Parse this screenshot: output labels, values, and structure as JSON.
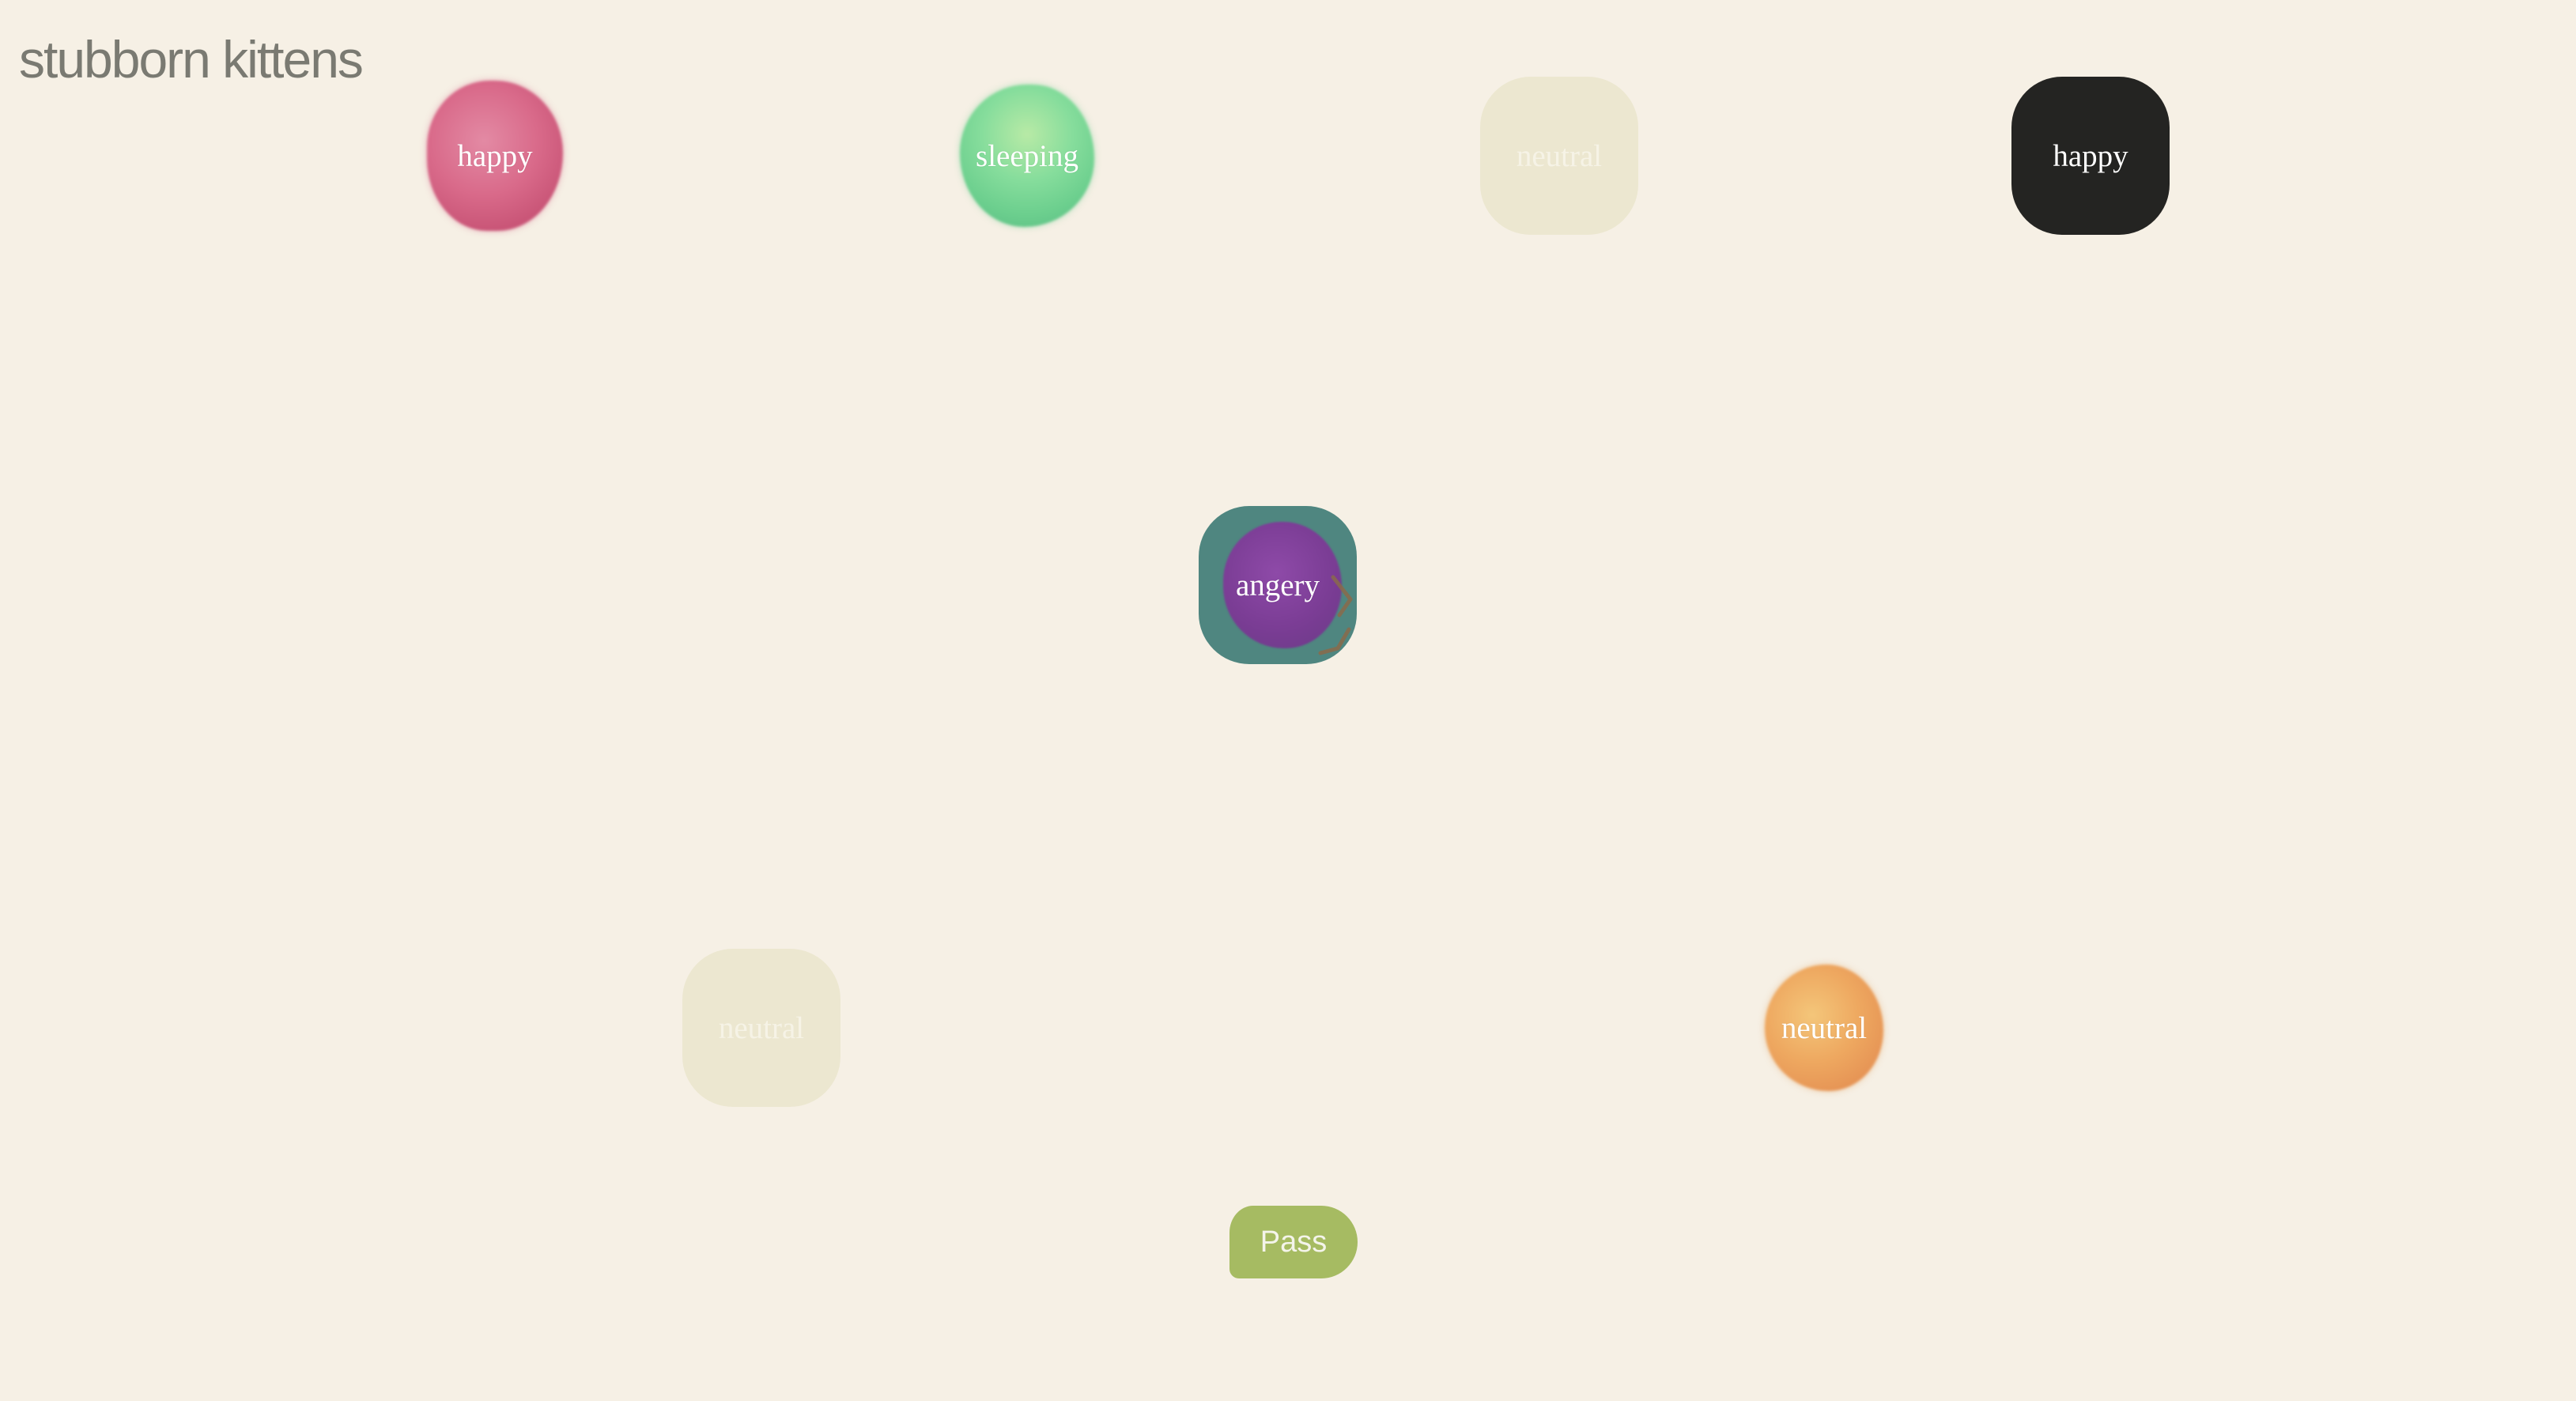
{
  "app": {
    "title": "stubborn kittens"
  },
  "tokens": [
    {
      "label": "happy",
      "style": "pink-blob",
      "color": "#d96a8a"
    },
    {
      "label": "sleeping",
      "style": "green-blob",
      "color": "#7fd69a"
    },
    {
      "label": "neutral",
      "style": "ghost-tile",
      "color": "#ece7d0"
    },
    {
      "label": "happy",
      "style": "black-tile",
      "color": "#242422"
    },
    {
      "label": "angery",
      "style": "teal-tile-purple-blob",
      "color": "#4f8680",
      "accent": "#7b3d95"
    },
    {
      "label": "neutral",
      "style": "ghost-tile",
      "color": "#ece7d0"
    },
    {
      "label": "neutral",
      "style": "orange-blob",
      "color": "#eea860"
    }
  ],
  "controls": {
    "pass_label": "Pass",
    "pass_color": "#a6bb62"
  },
  "colors": {
    "background": "#f6f0e5",
    "title_text": "#7a7a72"
  }
}
